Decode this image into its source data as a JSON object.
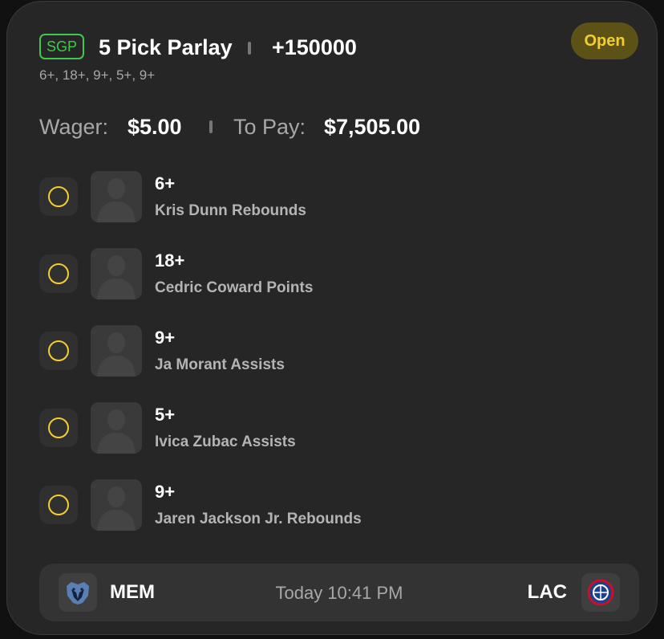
{
  "bet": {
    "badge": "SGP",
    "title": "5 Pick Parlay",
    "odds": "+150000",
    "subtitle": "6+, 18+, 9+, 5+, 9+",
    "status": "Open",
    "wager_label": "Wager:",
    "wager_value": "$5.00",
    "pay_label": "To Pay:",
    "pay_value": "$7,505.00"
  },
  "legs": [
    {
      "value": "6+",
      "label": "Kris Dunn Rebounds"
    },
    {
      "value": "18+",
      "label": "Cedric Coward Points"
    },
    {
      "value": "9+",
      "label": "Ja Morant Assists"
    },
    {
      "value": "5+",
      "label": "Ivica Zubac Assists"
    },
    {
      "value": "9+",
      "label": "Jaren Jackson Jr. Rebounds"
    }
  ],
  "game": {
    "home": "MEM",
    "away": "LAC",
    "time": "Today 10:41 PM"
  },
  "icons": {
    "leg_status": "open-circle-icon",
    "avatar": "player-silhouette-icon",
    "home_logo": "grizzlies-logo",
    "away_logo": "clippers-logo"
  },
  "colors": {
    "sgp": "#3fc94a",
    "status_text": "#f2cf2a",
    "status_bg": "#5c5218",
    "card_bg": "#262626"
  }
}
